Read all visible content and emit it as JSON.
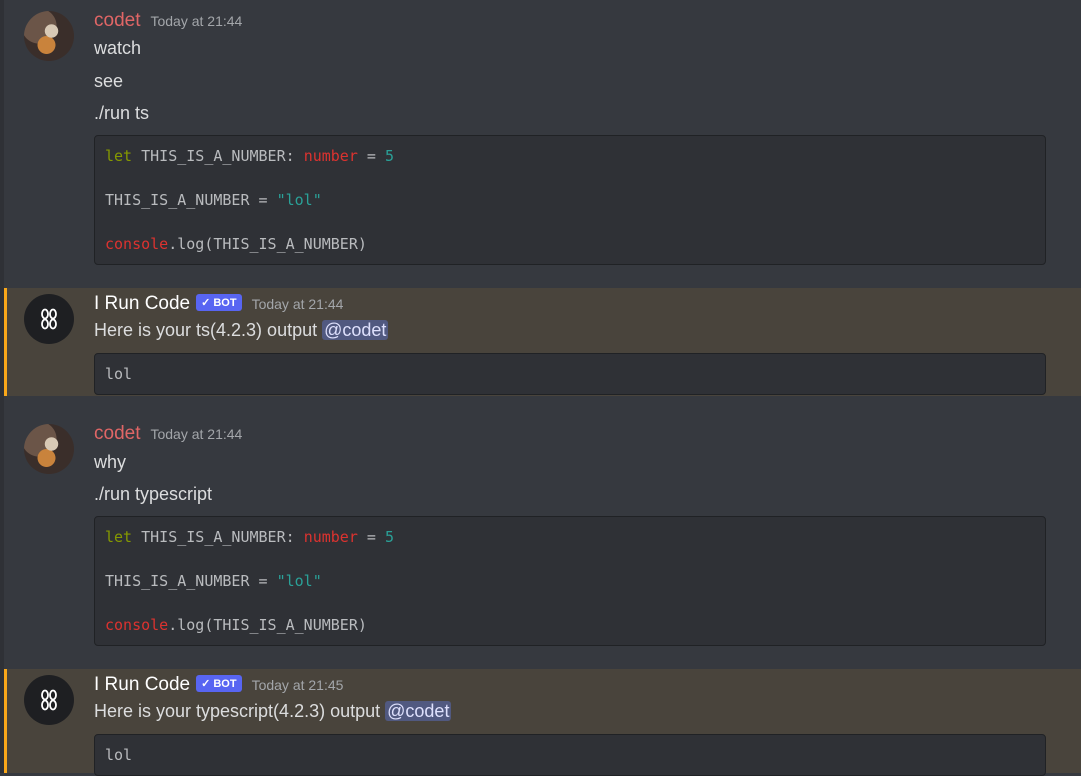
{
  "messages": [
    {
      "author": "codet",
      "timestamp": "Today at 21:44",
      "lines": [
        "watch",
        "see",
        "./run ts"
      ],
      "code": {
        "line1": {
          "keyword": "let",
          "name": " THIS_IS_A_NUMBER: ",
          "type": "number",
          "eq": " = ",
          "value": "5"
        },
        "line2": {
          "name": "THIS_IS_A_NUMBER = ",
          "value": "\"lol\""
        },
        "line3": {
          "obj": "console",
          "rest": ".log(THIS_IS_A_NUMBER)"
        }
      }
    },
    {
      "author": "I Run Code",
      "badge": "BOT",
      "timestamp": "Today at 21:44",
      "text": "Here is your ts(4.2.3) output ",
      "mention": "@codet",
      "output": "lol"
    },
    {
      "author": "codet",
      "timestamp": "Today at 21:44",
      "lines": [
        "why",
        "./run typescript"
      ],
      "code": {
        "line1": {
          "keyword": "let",
          "name": " THIS_IS_A_NUMBER: ",
          "type": "number",
          "eq": " = ",
          "value": "5"
        },
        "line2": {
          "name": "THIS_IS_A_NUMBER = ",
          "value": "\"lol\""
        },
        "line3": {
          "obj": "console",
          "rest": ".log(THIS_IS_A_NUMBER)"
        }
      }
    },
    {
      "author": "I Run Code",
      "badge": "BOT",
      "timestamp": "Today at 21:45",
      "text": "Here is your typescript(4.2.3) output ",
      "mention": "@codet",
      "output": "lol"
    }
  ],
  "colors": {
    "background": "#36393f",
    "mention_highlight": "#49443c",
    "mention_bar": "#faa81a",
    "bot_badge": "#5865f2",
    "username_codet": "#e06666"
  },
  "icons": {
    "bot_avatar": "bot-logo-icon",
    "verified": "checkmark-icon"
  }
}
